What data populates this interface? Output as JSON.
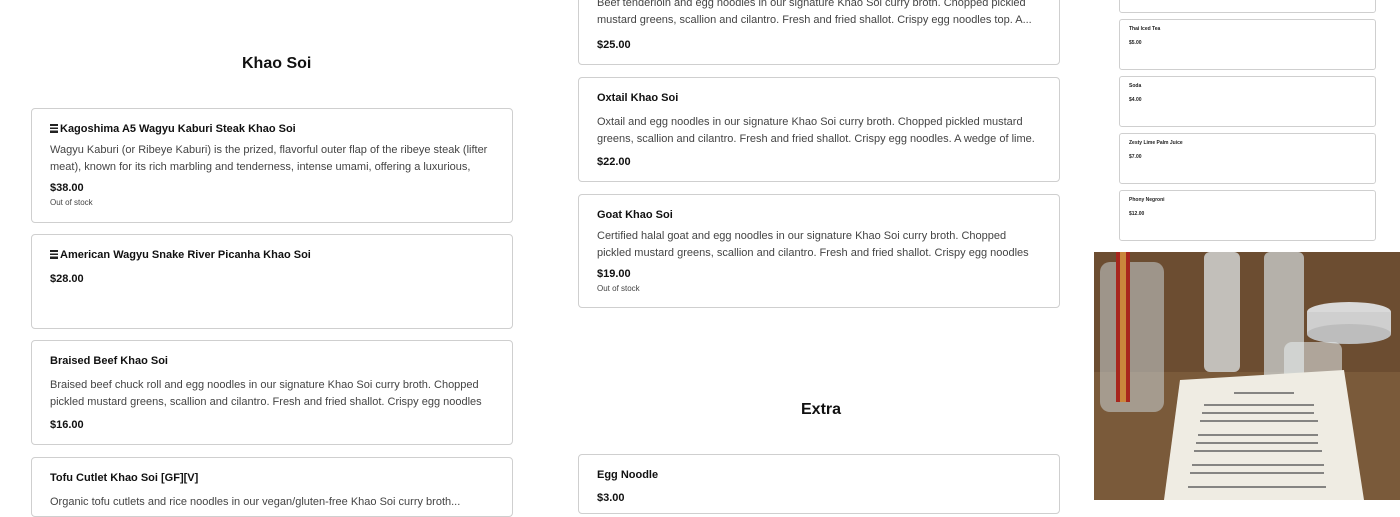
{
  "sections": {
    "khao_soi": "Khao Soi",
    "extra": "Extra"
  },
  "left_items": [
    {
      "name": "Kagoshima A5 Wagyu Kaburi Steak Khao Soi",
      "desc": "Wagyu Kaburi (or Ribeye Kaburi) is the prized, flavorful outer flap of the ribeye steak (lifter meat), known for its rich marbling and tenderness, intense umami, offering a luxurious, melt...",
      "price": "$38.00",
      "stock": "Out of stock"
    },
    {
      "name": "American Wagyu Snake River Picanha Khao Soi",
      "desc": "",
      "price": "$28.00",
      "stock": ""
    },
    {
      "name": "Braised Beef Khao Soi",
      "desc": "Braised beef chuck roll and egg noodles in our signature Khao Soi curry broth. Chopped pickled mustard greens, scallion and cilantro. Fresh and fried shallot. Crispy egg noodles to...",
      "price": "$16.00",
      "stock": ""
    },
    {
      "name": "Tofu Cutlet Khao Soi [GF][V]",
      "desc": "Organic tofu cutlets and rice noodles in our vegan/gluten-free Khao Soi curry broth...",
      "price": "",
      "stock": ""
    }
  ],
  "mid_items": [
    {
      "name": "",
      "desc": "Beef tenderloin and egg noodles in our signature Khao Soi curry broth. Chopped pickled mustard greens, scallion and cilantro. Fresh and fried shallot. Crispy egg noodles top. A...",
      "price": "$25.00",
      "stock": ""
    },
    {
      "name": "Oxtail Khao Soi",
      "desc": "Oxtail and egg noodles in our signature Khao Soi curry broth. Chopped pickled mustard greens, scallion and cilantro. Fresh and fried shallot. Crispy egg noodles. A wedge of lime.",
      "price": "$22.00",
      "stock": ""
    },
    {
      "name": "Goat Khao Soi",
      "desc": "Certified halal goat and egg noodles in our signature Khao Soi curry broth. Chopped pickled mustard greens, scallion and cilantro. Fresh and fried shallot. Crispy egg noodles top. A...",
      "price": "$19.00",
      "stock": "Out of stock"
    },
    {
      "name": "Egg Noodle",
      "desc": "",
      "price": "$3.00",
      "stock": ""
    }
  ],
  "drinks": [
    {
      "name": "",
      "price": ""
    },
    {
      "name": "Thai Iced Tea",
      "price": "$5.00"
    },
    {
      "name": "Soda",
      "price": "$4.00"
    },
    {
      "name": "Zesty Lime Palm Juice",
      "price": "$7.00"
    },
    {
      "name": "Phony Negroni",
      "price": "$12.00"
    }
  ],
  "colors": {
    "border": "#cfcfcf",
    "text": "#222222",
    "muted": "#444444"
  }
}
